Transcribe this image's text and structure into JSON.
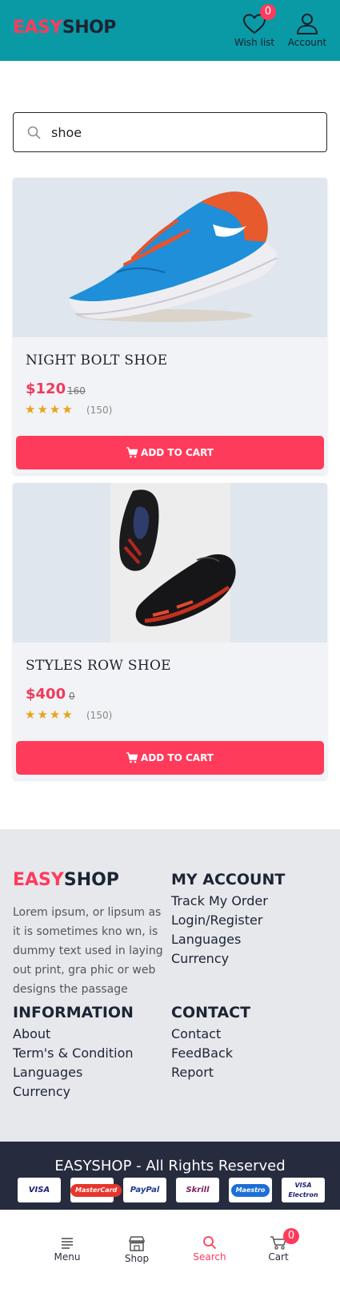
{
  "header": {
    "logo_part1": "EASY",
    "logo_part2": "SHOP",
    "wishlist_label": "Wish list",
    "wishlist_count": "0",
    "account_label": "Account"
  },
  "search": {
    "value": "shoe",
    "placeholder": ""
  },
  "products": [
    {
      "name": "NIGHT BOLT SHOE",
      "price": "$120",
      "old_price": "160",
      "rating": 4,
      "reviews": "(150)",
      "cta": "ADD TO CART"
    },
    {
      "name": "STYLES ROW SHOE",
      "price": "$400",
      "old_price": "0",
      "rating": 4,
      "reviews": "(150)",
      "cta": "ADD TO CART"
    }
  ],
  "footer": {
    "logo_part1": "EASY",
    "logo_part2": "SHOP",
    "description": "Lorem ipsum, or lipsum as it is sometimes kno wn, is dummy text used in laying out print, gra phic or web designs the passage",
    "my_account": {
      "heading": "MY ACCOUNT",
      "items": [
        "Track My Order",
        "Login/Register",
        "Languages",
        "Currency"
      ]
    },
    "information": {
      "heading": "INFORMATION",
      "items": [
        "About",
        "Term's & Condition",
        "Languages",
        "Currency"
      ]
    },
    "contact": {
      "heading": "CONTACT",
      "items": [
        "Contact",
        "FeedBack",
        "Report"
      ]
    }
  },
  "copyright": {
    "text": "EASYSHOP - All Rights Reserved",
    "payment_methods": [
      "VISA",
      "MasterCard",
      "PayPal",
      "Skrill",
      "Maestro",
      "VISA Electron"
    ]
  },
  "bottom_nav": {
    "menu": "Menu",
    "shop": "Shop",
    "search": "Search",
    "cart": "Cart",
    "cart_count": "0"
  },
  "colors": {
    "header_bg": "#0a9aa6",
    "accent": "#ff3b5c",
    "dark": "#1d2433",
    "footer_bg": "#e6e8ec",
    "copyright_bg": "#262b3e",
    "star": "#e8a317"
  }
}
